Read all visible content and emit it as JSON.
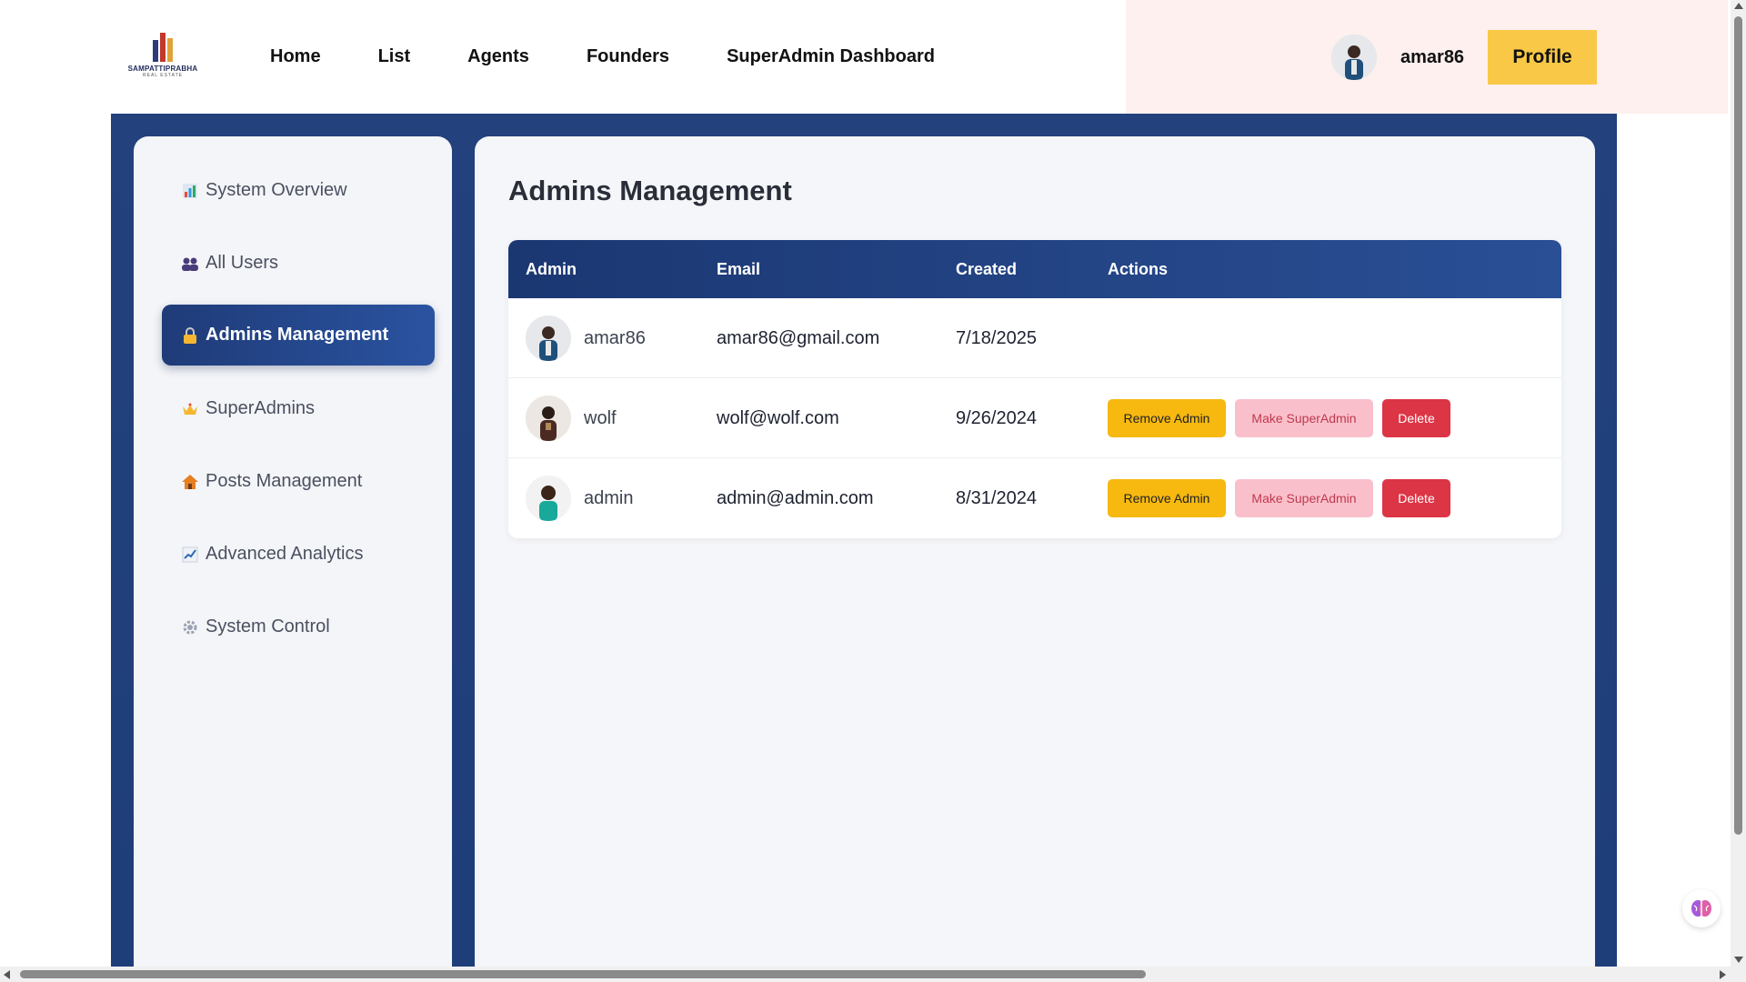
{
  "brand": {
    "name": "SAMPATTIPRABHA",
    "tagline": "REAL ESTATE"
  },
  "nav": {
    "items": [
      {
        "label": "Home"
      },
      {
        "label": "List"
      },
      {
        "label": "Agents"
      },
      {
        "label": "Founders"
      },
      {
        "label": "SuperAdmin Dashboard"
      }
    ]
  },
  "user": {
    "name": "amar86",
    "profile_label": "Profile"
  },
  "sidebar": {
    "items": [
      {
        "icon": "bar-chart-icon",
        "label": "System Overview"
      },
      {
        "icon": "users-icon",
        "label": "All Users"
      },
      {
        "icon": "lock-icon",
        "label": "Admins Management",
        "active": true
      },
      {
        "icon": "crown-icon",
        "label": "SuperAdmins"
      },
      {
        "icon": "house-icon",
        "label": "Posts Management"
      },
      {
        "icon": "trend-chart-icon",
        "label": "Advanced Analytics"
      },
      {
        "icon": "gear-icon",
        "label": "System Control"
      }
    ]
  },
  "main": {
    "title": "Admins Management",
    "table": {
      "columns": [
        "Admin",
        "Email",
        "Created",
        "Actions"
      ],
      "rows": [
        {
          "name": "amar86",
          "email": "amar86@gmail.com",
          "created": "7/18/2025",
          "actions": []
        },
        {
          "name": "wolf",
          "email": "wolf@wolf.com",
          "created": "9/26/2024",
          "actions": [
            "Remove Admin",
            "Make SuperAdmin",
            "Delete"
          ]
        },
        {
          "name": "admin",
          "email": "admin@admin.com",
          "created": "8/31/2024",
          "actions": [
            "Remove Admin",
            "Make SuperAdmin",
            "Delete"
          ]
        }
      ]
    }
  },
  "colors": {
    "primary": "#1f3b78",
    "accent_yellow": "#f9c846",
    "remove_btn": "#f7b90f",
    "make_super_btn": "#f9c0cb",
    "delete_btn": "#dc3545"
  }
}
